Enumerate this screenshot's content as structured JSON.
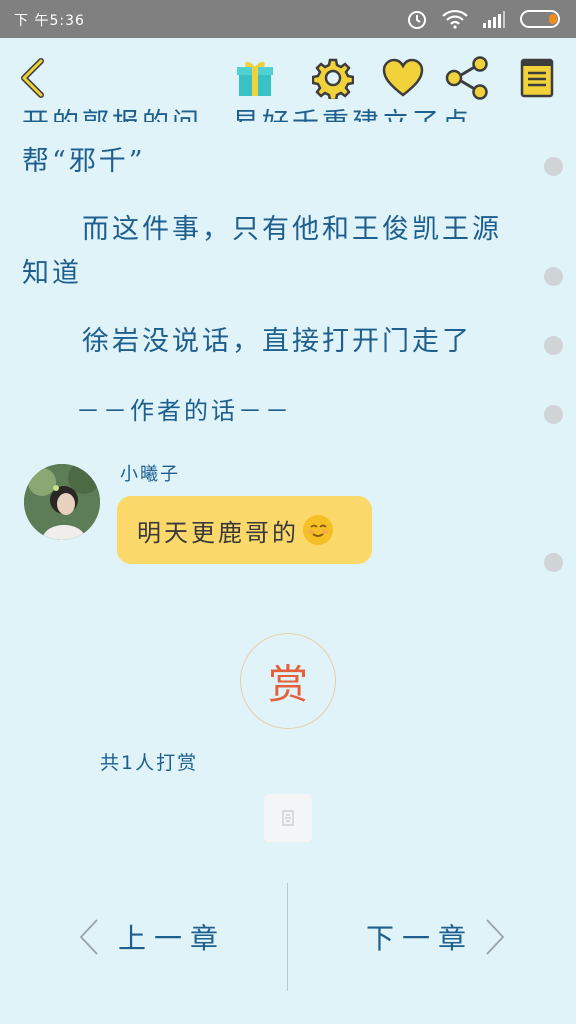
{
  "status_bar": {
    "time": "下 午5:36"
  },
  "toolbar": {
    "back_icon": "chevron-left-icon",
    "gift_icon": "gift-icon",
    "settings_icon": "gear-icon",
    "like_icon": "heart-icon",
    "share_icon": "share-icon",
    "catalog_icon": "book-icon",
    "colors": {
      "accent": "#f2d23a",
      "outline": "#3d3d3d"
    }
  },
  "content": {
    "partial_top": "开的郭报的问，易好千重建立了点",
    "paragraphs": [
      "帮“邪千”",
      "　　而这件事，只有他和王俊凯王源知道",
      "　　徐岩没说话，直接打开门走了",
      "　　－－作者的话－－"
    ]
  },
  "author_note": {
    "name": "小曦子",
    "message": "明天更鹿哥的"
  },
  "reward": {
    "button_label": "赏",
    "count_text": "共1人打赏"
  },
  "navigation": {
    "prev_label": "上一章",
    "next_label": "下一章"
  }
}
